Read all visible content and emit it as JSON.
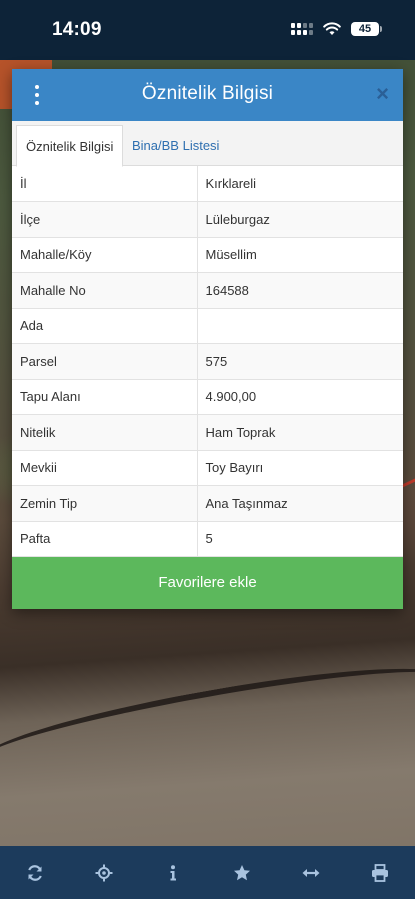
{
  "status_bar": {
    "time": "14:09",
    "battery": "45"
  },
  "modal": {
    "title": "Öznitelik Bilgisi",
    "close_label": "×",
    "tabs": [
      {
        "label": "Öznitelik Bilgisi",
        "active": true
      },
      {
        "label": "Bina/BB Listesi",
        "active": false
      }
    ],
    "rows": [
      {
        "key": "İl",
        "value": "Kırklareli"
      },
      {
        "key": "İlçe",
        "value": "Lüleburgaz"
      },
      {
        "key": "Mahalle/Köy",
        "value": "Müsellim"
      },
      {
        "key": "Mahalle No",
        "value": "164588"
      },
      {
        "key": "Ada",
        "value": ""
      },
      {
        "key": "Parsel",
        "value": "575"
      },
      {
        "key": "Tapu Alanı",
        "value": "4.900,00"
      },
      {
        "key": "Nitelik",
        "value": "Ham Toprak"
      },
      {
        "key": "Mevkii",
        "value": "Toy Bayırı"
      },
      {
        "key": "Zemin Tip",
        "value": "Ana Taşınmaz"
      },
      {
        "key": "Pafta",
        "value": "5"
      }
    ],
    "favorite_button": "Favorilere ekle"
  },
  "toolbar": {
    "items": [
      "refresh-icon",
      "locate-icon",
      "info-icon",
      "star-icon",
      "measure-icon",
      "print-icon"
    ]
  },
  "colors": {
    "header_blue": "#3a86c6",
    "toolbar_navy": "#1c3b5c",
    "favorite_green": "#5cb85c",
    "tab_link_blue": "#2e6fb0"
  }
}
